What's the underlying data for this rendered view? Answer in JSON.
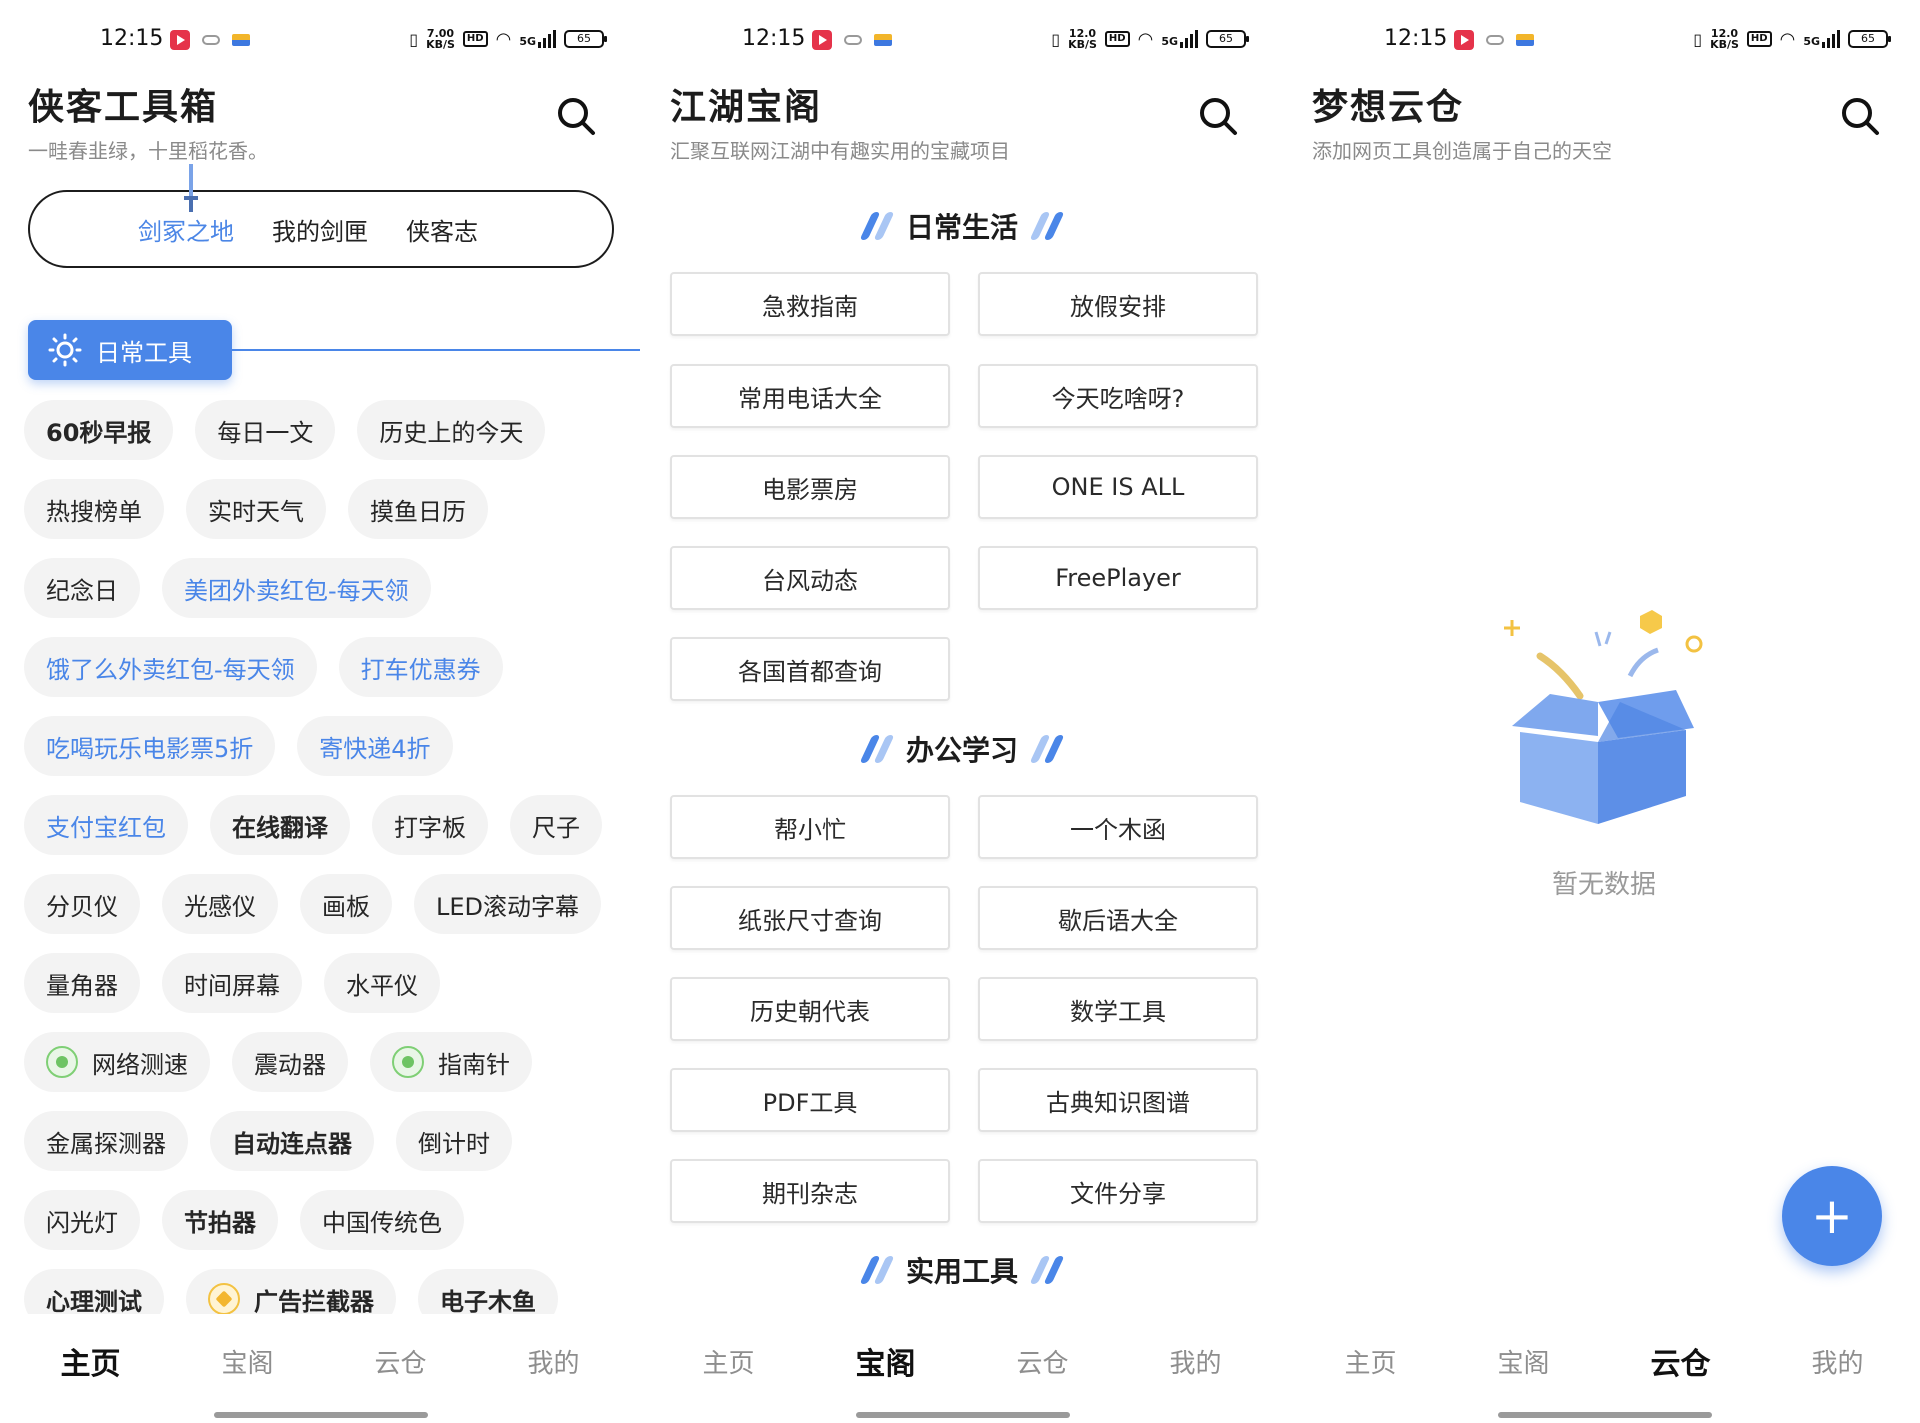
{
  "status": {
    "time": "12:15",
    "speed_p1": [
      "7.00",
      "KB/S"
    ],
    "speed_p2": [
      "12.0",
      "KB/S"
    ],
    "speed_p3": [
      "12.0",
      "KB/S"
    ],
    "hd": "HD",
    "net": "5G",
    "battery": "65"
  },
  "nav": {
    "home": "主页",
    "pavilion": "宝阁",
    "cloud": "云仓",
    "mine": "我的"
  },
  "panel1": {
    "title": "侠客工具箱",
    "subtitle": "一畦春韭绿，十里稻花香。",
    "tabs": [
      "剑冢之地",
      "我的剑匣",
      "侠客志"
    ],
    "category": "日常工具",
    "chips": [
      [
        "60秒早报",
        "每日一文",
        "历史上的今天"
      ],
      [
        "热搜榜单",
        "实时天气",
        "摸鱼日历"
      ],
      [
        "纪念日",
        "美团外卖红包-每天领"
      ],
      [
        "饿了么外卖红包-每天领",
        "打车优惠券"
      ],
      [
        "吃喝玩乐电影票5折",
        "寄快递4折"
      ],
      [
        "支付宝红包",
        "在线翻译",
        "打字板",
        "尺子"
      ],
      [
        "分贝仪",
        "光感仪",
        "画板",
        "LED滚动字幕"
      ],
      [
        "量角器",
        "时间屏幕",
        "水平仪"
      ],
      [
        "网络测速",
        "震动器",
        "指南针"
      ],
      [
        "金属探测器",
        "自动连点器",
        "倒计时"
      ],
      [
        "闪光灯",
        "节拍器",
        "中国传统色"
      ],
      [
        "心理测试",
        "广告拦截器",
        "电子木鱼"
      ]
    ]
  },
  "panel2": {
    "title": "江湖宝阁",
    "subtitle": "汇聚互联网江湖中有趣实用的宝藏项目",
    "sections": [
      {
        "title": "日常生活",
        "items": [
          "急救指南",
          "放假安排",
          "常用电话大全",
          "今天吃啥呀?",
          "电影票房",
          "ONE IS ALL",
          "台风动态",
          "FreePlayer",
          "各国首都查询"
        ]
      },
      {
        "title": "办公学习",
        "items": [
          "帮小忙",
          "一个木函",
          "纸张尺寸查询",
          "歇后语大全",
          "历史朝代表",
          "数学工具",
          "PDF工具",
          "古典知识图谱",
          "期刊杂志",
          "文件分享"
        ]
      },
      {
        "title": "实用工具",
        "items": []
      }
    ]
  },
  "panel3": {
    "title": "梦想云仓",
    "subtitle": "添加网页工具创造属于自己的天空",
    "empty": "暂无数据",
    "fab": "+"
  },
  "colors": {
    "accent": "#4a86e8",
    "chip_bg": "#f3f3f3",
    "muted": "#8a8a8a"
  }
}
